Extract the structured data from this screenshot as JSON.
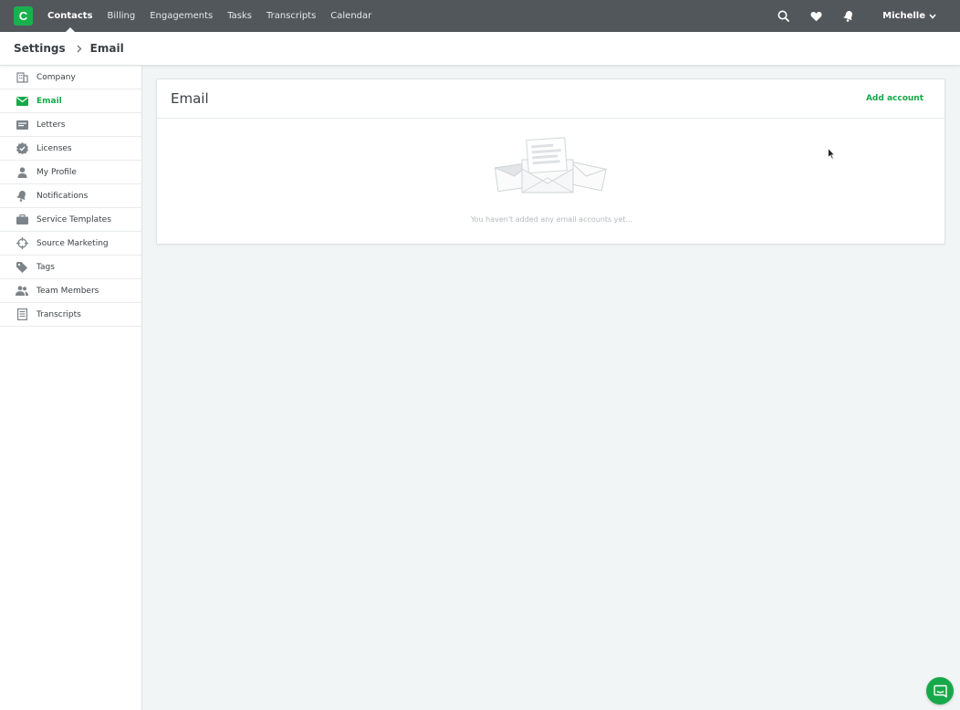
{
  "topbar": {
    "logo_letter": "C",
    "nav": [
      {
        "label": "Contacts",
        "active": true
      },
      {
        "label": "Billing"
      },
      {
        "label": "Engagements"
      },
      {
        "label": "Tasks"
      },
      {
        "label": "Transcripts"
      },
      {
        "label": "Calendar"
      }
    ],
    "icons": [
      "search-icon",
      "heart-icon",
      "bell-icon"
    ],
    "user_name": "Michelle"
  },
  "breadcrumb": {
    "root": "Settings",
    "current": "Email"
  },
  "sidebar": {
    "items": [
      {
        "label": "Company",
        "icon": "building-icon"
      },
      {
        "label": "Email",
        "icon": "envelope-icon",
        "active": true
      },
      {
        "label": "Letters",
        "icon": "letters-icon"
      },
      {
        "label": "Licenses",
        "icon": "badge-icon"
      },
      {
        "label": "My Profile",
        "icon": "user-icon"
      },
      {
        "label": "Notifications",
        "icon": "bell-icon"
      },
      {
        "label": "Service Templates",
        "icon": "briefcase-icon"
      },
      {
        "label": "Source Marketing",
        "icon": "crosshair-icon"
      },
      {
        "label": "Tags",
        "icon": "tag-icon"
      },
      {
        "label": "Team Members",
        "icon": "team-icon"
      },
      {
        "label": "Transcripts",
        "icon": "document-icon"
      }
    ]
  },
  "main": {
    "title": "Email",
    "add_account_label": "Add account",
    "empty_message": "You haven't added any email accounts yet..."
  },
  "colors": {
    "accent": "#17a849",
    "topbar": "#52575c",
    "background": "#f2f5f5"
  }
}
